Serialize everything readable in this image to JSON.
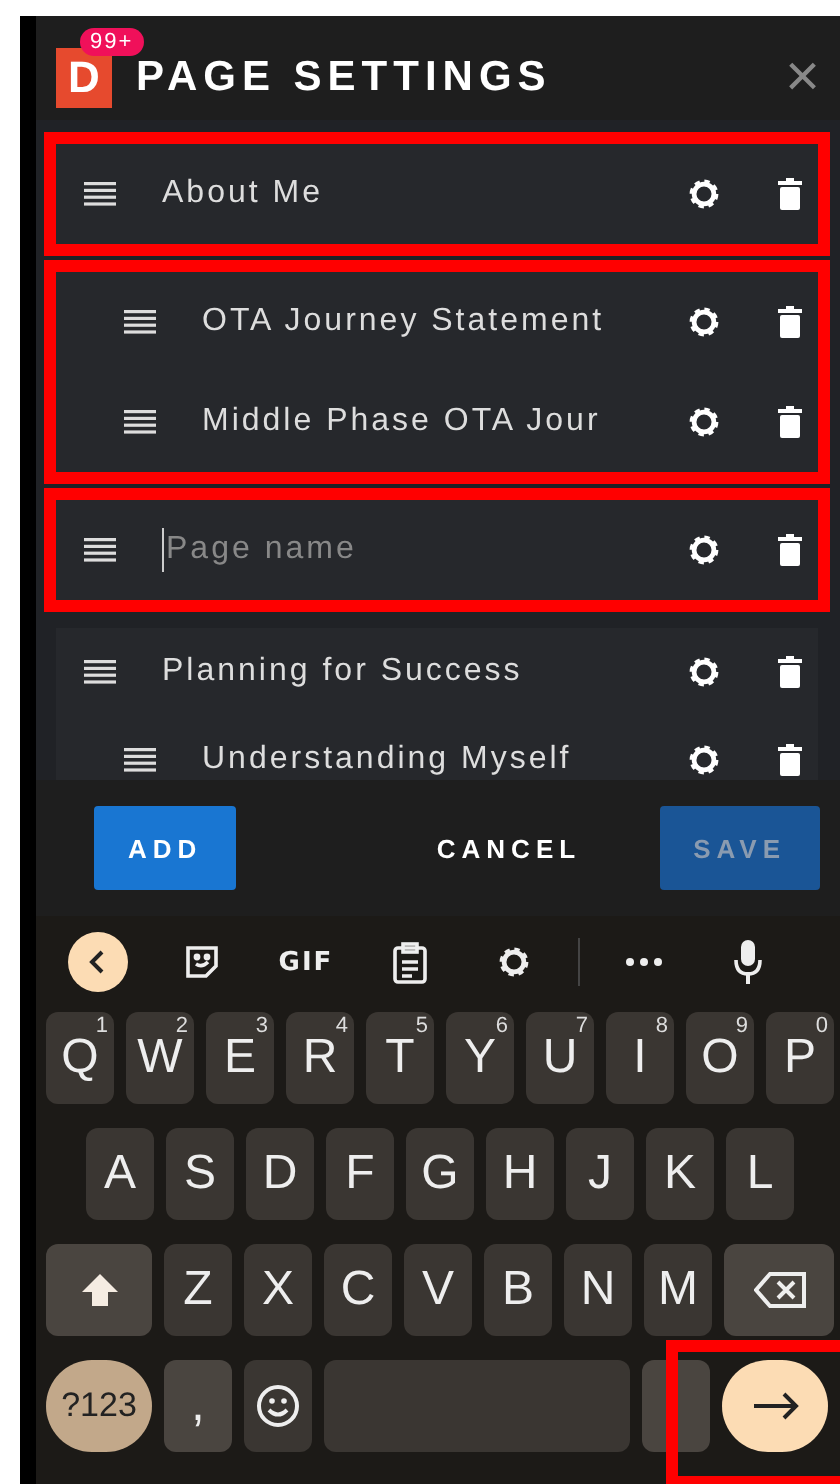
{
  "header": {
    "logo": "D",
    "badge": "99+",
    "title": "PAGE SETTINGS",
    "close": "×"
  },
  "sections": [
    {
      "highlighted": true,
      "rows": [
        {
          "kind": "page",
          "label": "About Me",
          "indented": false
        }
      ]
    },
    {
      "highlighted": true,
      "rows": [
        {
          "kind": "page",
          "label": "OTA Journey Statement",
          "indented": true
        },
        {
          "kind": "page",
          "label": "Middle Phase OTA Jour",
          "indented": true
        }
      ]
    },
    {
      "highlighted": true,
      "rows": [
        {
          "kind": "input",
          "placeholder": "Page name",
          "indented": false
        }
      ]
    },
    {
      "highlighted": false,
      "rows": [
        {
          "kind": "page",
          "label": "Planning for Success",
          "indented": false
        },
        {
          "kind": "page",
          "label": "Understanding Myself",
          "indented": true
        }
      ]
    }
  ],
  "buttons": [
    {
      "label": "ADD",
      "kind": "primary",
      "disabled": false
    },
    {
      "label": "CANCEL",
      "kind": "text",
      "disabled": false
    },
    {
      "label": "SAVE",
      "kind": "primary",
      "disabled": true
    }
  ],
  "keyboard": {
    "toolbar": [
      {
        "kind": "back"
      },
      {
        "kind": "sticker"
      },
      {
        "kind": "text",
        "label": "GIF"
      },
      {
        "kind": "clipboard"
      },
      {
        "kind": "settings"
      },
      {
        "kind": "divider"
      },
      {
        "kind": "more"
      },
      {
        "kind": "mic"
      }
    ],
    "rows": [
      [
        {
          "kind": "letter",
          "label": "Q",
          "hint": "1"
        },
        {
          "kind": "letter",
          "label": "W",
          "hint": "2"
        },
        {
          "kind": "letter",
          "label": "E",
          "hint": "3"
        },
        {
          "kind": "letter",
          "label": "R",
          "hint": "4"
        },
        {
          "kind": "letter",
          "label": "T",
          "hint": "5"
        },
        {
          "kind": "letter",
          "label": "Y",
          "hint": "6"
        },
        {
          "kind": "letter",
          "label": "U",
          "hint": "7"
        },
        {
          "kind": "letter",
          "label": "I",
          "hint": "8"
        },
        {
          "kind": "letter",
          "label": "O",
          "hint": "9"
        },
        {
          "kind": "letter",
          "label": "P",
          "hint": "0"
        }
      ],
      [
        {
          "kind": "letter",
          "label": "A"
        },
        {
          "kind": "letter",
          "label": "S"
        },
        {
          "kind": "letter",
          "label": "D"
        },
        {
          "kind": "letter",
          "label": "F"
        },
        {
          "kind": "letter",
          "label": "G"
        },
        {
          "kind": "letter",
          "label": "H"
        },
        {
          "kind": "letter",
          "label": "J"
        },
        {
          "kind": "letter",
          "label": "K"
        },
        {
          "kind": "letter",
          "label": "L"
        }
      ],
      [
        {
          "kind": "shift"
        },
        {
          "kind": "letter",
          "label": "Z"
        },
        {
          "kind": "letter",
          "label": "X"
        },
        {
          "kind": "letter",
          "label": "C"
        },
        {
          "kind": "letter",
          "label": "V"
        },
        {
          "kind": "letter",
          "label": "B"
        },
        {
          "kind": "letter",
          "label": "N"
        },
        {
          "kind": "letter",
          "label": "M"
        },
        {
          "kind": "backspace"
        }
      ],
      [
        {
          "kind": "symbols",
          "label": "?123"
        },
        {
          "kind": "comma",
          "label": ","
        },
        {
          "kind": "emoji"
        },
        {
          "kind": "space"
        },
        {
          "kind": "blank"
        },
        {
          "kind": "enter",
          "highlighted": true
        }
      ]
    ]
  }
}
